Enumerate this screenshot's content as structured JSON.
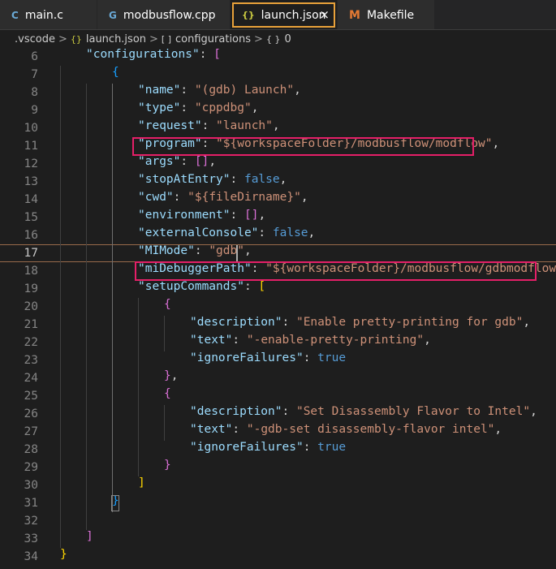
{
  "tabs": [
    {
      "label": "main.c",
      "icon": "c-file-icon",
      "glyph": "C",
      "active": false
    },
    {
      "label": "modbusflow.cpp",
      "icon": "cpp-file-icon",
      "glyph": "G",
      "active": false
    },
    {
      "label": "launch.json",
      "icon": "json-file-icon",
      "glyph": "{}",
      "active": true,
      "close": "×"
    },
    {
      "label": "Makefile",
      "icon": "makefile-icon",
      "glyph": "M",
      "active": false
    }
  ],
  "breadcrumb": {
    "folder": ".vscode",
    "file": "launch.json",
    "file_glyph": "{}",
    "array": "configurations",
    "array_glyph": "[ ]",
    "object": "0",
    "object_glyph": "{ }",
    "sep": ">"
  },
  "editor": {
    "current_line": "17",
    "lines": [
      {
        "n": "6"
      },
      {
        "n": "7"
      },
      {
        "n": "8"
      },
      {
        "n": "9"
      },
      {
        "n": "10"
      },
      {
        "n": "11"
      },
      {
        "n": "12"
      },
      {
        "n": "13"
      },
      {
        "n": "14"
      },
      {
        "n": "15"
      },
      {
        "n": "16"
      },
      {
        "n": "17"
      },
      {
        "n": "18"
      },
      {
        "n": "19"
      },
      {
        "n": "20"
      },
      {
        "n": "21"
      },
      {
        "n": "22"
      },
      {
        "n": "23"
      },
      {
        "n": "24"
      },
      {
        "n": "25"
      },
      {
        "n": "26"
      },
      {
        "n": "27"
      },
      {
        "n": "28"
      },
      {
        "n": "29"
      },
      {
        "n": "30"
      },
      {
        "n": "31"
      },
      {
        "n": "32"
      },
      {
        "n": "33"
      },
      {
        "n": "34"
      }
    ],
    "code": {
      "l6_key": "\"configurations\"",
      "l6_bracket": "[",
      "l7_brace": "{",
      "l8_key": "\"name\"",
      "l8_val": "\"(gdb) Launch\"",
      "l9_key": "\"type\"",
      "l9_val": "\"cppdbg\"",
      "l10_key": "\"request\"",
      "l10_val": "\"launch\"",
      "l11_key": "\"program\"",
      "l11_val": "\"${workspaceFolder}/modbusflow/modflow\"",
      "l12_key": "\"args\"",
      "l12_val": "[]",
      "l13_key": "\"stopAtEntry\"",
      "l13_val": "false",
      "l14_key": "\"cwd\"",
      "l14_val": "\"${fileDirname}\"",
      "l15_key": "\"environment\"",
      "l15_val": "[]",
      "l16_key": "\"externalConsole\"",
      "l16_val": "false",
      "l17_key": "\"MIMode\"",
      "l17_val": "\"gdb\"",
      "l18_key": "\"miDebuggerPath\"",
      "l18_val": "\"${workspaceFolder}/modbusflow/gdbmodflow\"",
      "l19_key": "\"setupCommands\"",
      "l19_bracket": "[",
      "l20_brace": "{",
      "l21_key": "\"description\"",
      "l21_val": "\"Enable pretty-printing for gdb\"",
      "l22_key": "\"text\"",
      "l22_val": "\"-enable-pretty-printing\"",
      "l23_key": "\"ignoreFailures\"",
      "l23_val": "true",
      "l24_brace": "}",
      "l25_brace": "{",
      "l26_key": "\"description\"",
      "l26_val": "\"Set Disassembly Flavor to Intel\"",
      "l27_key": "\"text\"",
      "l27_val": "\"-gdb-set disassembly-flavor intel\"",
      "l28_key": "\"ignoreFailures\"",
      "l28_val": "true",
      "l29_brace": "}",
      "l30_bracket": "]",
      "l31_brace": "}",
      "l33_bracket": "]",
      "l34_brace": "}"
    }
  },
  "colors": {
    "background": "#1e1e1e",
    "key": "#9cdcfe",
    "string": "#ce9178",
    "boolean": "#569cd6",
    "highlight_box": "#e51f68",
    "active_tab_outline": "#e8a13a"
  }
}
